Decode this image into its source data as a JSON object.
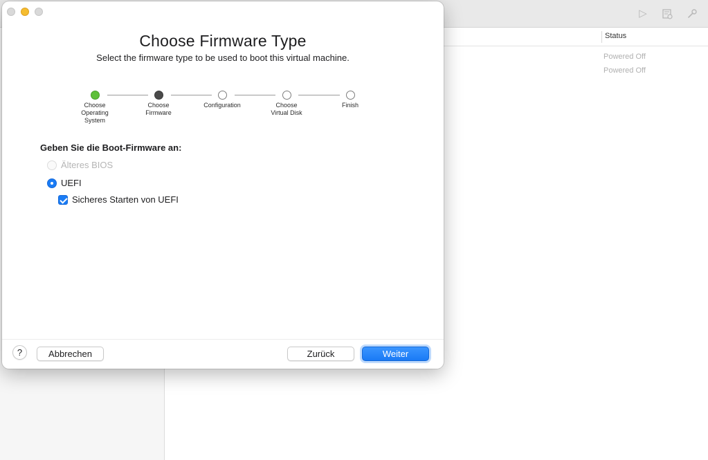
{
  "background": {
    "table": {
      "status_header": "Status",
      "rows": [
        {
          "status": "Powered Off"
        },
        {
          "status": "Powered Off"
        }
      ]
    },
    "toolbar_icons": [
      "play-icon",
      "snapshot-icon",
      "wrench-icon"
    ]
  },
  "dialog": {
    "title": "Choose Firmware Type",
    "subtitle": "Select the firmware type to be used to boot this virtual machine.",
    "steps": [
      {
        "label": "Choose\nOperating\nSystem",
        "state": "done"
      },
      {
        "label": "Choose\nFirmware",
        "state": "current"
      },
      {
        "label": "Configuration",
        "state": "todo"
      },
      {
        "label": "Choose\nVirtual Disk",
        "state": "todo"
      },
      {
        "label": "Finish",
        "state": "todo"
      }
    ],
    "section_heading": "Geben Sie die Boot-Firmware an:",
    "options": {
      "legacy_bios": {
        "label": "Älteres BIOS",
        "selected": false,
        "enabled": false
      },
      "uefi": {
        "label": "UEFI",
        "selected": true,
        "enabled": true
      },
      "secure_boot": {
        "label": "Sicheres Starten von UEFI",
        "checked": true
      }
    },
    "footer": {
      "help_label": "?",
      "cancel_label": "Abbrechen",
      "back_label": "Zurück",
      "next_label": "Weiter"
    }
  },
  "colors": {
    "accent": "#1a7cf5",
    "step_done": "#5fc03a",
    "step_current": "#4a4a4a",
    "traffic_minimize": "#f5bd30"
  }
}
